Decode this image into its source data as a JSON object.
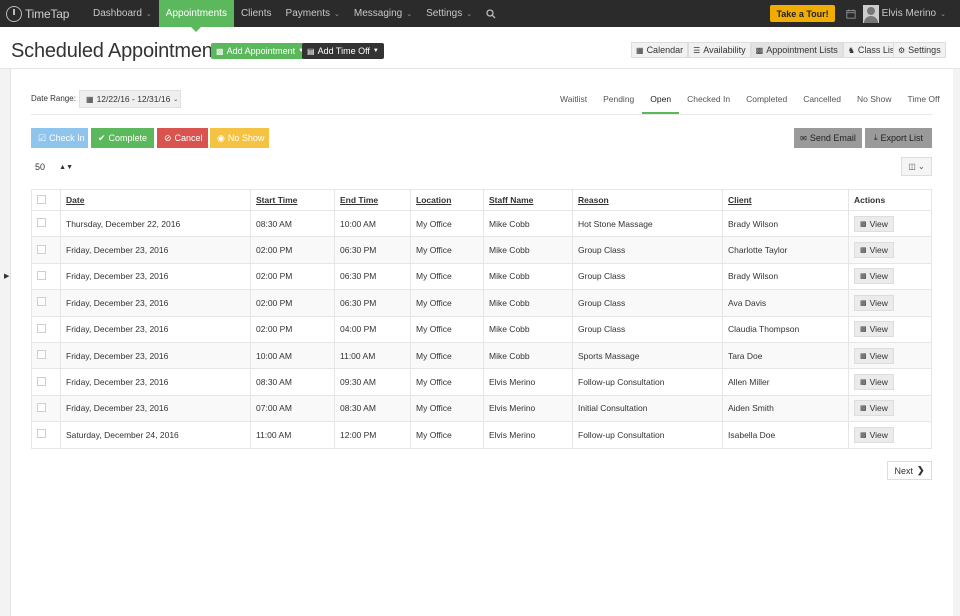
{
  "nav": {
    "logo_text": "TimeTap",
    "items": [
      {
        "label": "Dashboard",
        "has_chevron": true,
        "active": false
      },
      {
        "label": "Appointments",
        "has_chevron": false,
        "active": true
      },
      {
        "label": "Clients",
        "has_chevron": false,
        "active": false
      },
      {
        "label": "Payments",
        "has_chevron": true,
        "active": false
      },
      {
        "label": "Messaging",
        "has_chevron": true,
        "active": false
      },
      {
        "label": "Settings",
        "has_chevron": true,
        "active": false
      }
    ],
    "tour_label": "Take a Tour!",
    "user_name": "Elvis Merino",
    "colors": {
      "bar": "#2b2b2b",
      "active": "#5cb85c",
      "tour": "#f0ad00"
    }
  },
  "header": {
    "title": "Scheduled Appointments",
    "add_appointment_label": "Add Appointment",
    "add_time_off_label": "Add Time Off",
    "views": [
      {
        "label": "Calendar",
        "icon": "calendar-icon",
        "active": false
      },
      {
        "label": "Availability",
        "icon": "list-icon",
        "active": false
      },
      {
        "label": "Appointment Lists",
        "icon": "book-icon",
        "active": true
      },
      {
        "label": "Class Lists",
        "icon": "users-icon",
        "active": false
      }
    ],
    "settings_label": "Settings"
  },
  "filters": {
    "date_range_label": "Date Range:",
    "date_range_value": "12/22/16 - 12/31/16",
    "status_tabs": [
      {
        "label": "Waitlist",
        "active": false
      },
      {
        "label": "Pending",
        "active": false
      },
      {
        "label": "Open",
        "active": true
      },
      {
        "label": "Checked In",
        "active": false
      },
      {
        "label": "Completed",
        "active": false
      },
      {
        "label": "Cancelled",
        "active": false
      },
      {
        "label": "No Show",
        "active": false
      },
      {
        "label": "Time Off",
        "active": false
      }
    ]
  },
  "actions": {
    "check_in": "Check In",
    "complete": "Complete",
    "cancel": "Cancel",
    "no_show": "No Show",
    "send_email": "Send Email",
    "export_list": "Export List",
    "page_size": "50"
  },
  "table": {
    "columns": [
      "Date",
      "Start Time",
      "End Time",
      "Location",
      "Staff Name",
      "Reason",
      "Client",
      "Actions"
    ],
    "view_label": "View",
    "rows": [
      {
        "date": "Thursday, December 22, 2016",
        "start": "08:30 AM",
        "end": "10:00 AM",
        "location": "My Office",
        "staff": "Mike Cobb",
        "reason": "Hot Stone Massage",
        "client": "Brady Wilson"
      },
      {
        "date": "Friday, December 23, 2016",
        "start": "02:00 PM",
        "end": "06:30 PM",
        "location": "My Office",
        "staff": "Mike Cobb",
        "reason": "Group Class",
        "client": "Charlotte Taylor"
      },
      {
        "date": "Friday, December 23, 2016",
        "start": "02:00 PM",
        "end": "06:30 PM",
        "location": "My Office",
        "staff": "Mike Cobb",
        "reason": "Group Class",
        "client": "Brady Wilson"
      },
      {
        "date": "Friday, December 23, 2016",
        "start": "02:00 PM",
        "end": "06:30 PM",
        "location": "My Office",
        "staff": "Mike Cobb",
        "reason": "Group Class",
        "client": "Ava Davis"
      },
      {
        "date": "Friday, December 23, 2016",
        "start": "02:00 PM",
        "end": "04:00 PM",
        "location": "My Office",
        "staff": "Mike Cobb",
        "reason": "Group Class",
        "client": "Claudia Thompson"
      },
      {
        "date": "Friday, December 23, 2016",
        "start": "10:00 AM",
        "end": "11:00 AM",
        "location": "My Office",
        "staff": "Mike Cobb",
        "reason": "Sports Massage",
        "client": "Tara Doe"
      },
      {
        "date": "Friday, December 23, 2016",
        "start": "08:30 AM",
        "end": "09:30 AM",
        "location": "My Office",
        "staff": "Elvis Merino",
        "reason": "Follow-up Consultation",
        "client": "Allen Miller"
      },
      {
        "date": "Friday, December 23, 2016",
        "start": "07:00 AM",
        "end": "08:30 AM",
        "location": "My Office",
        "staff": "Elvis Merino",
        "reason": "Initial Consultation",
        "client": "Aiden Smith"
      },
      {
        "date": "Saturday, December 24, 2016",
        "start": "11:00 AM",
        "end": "12:00 PM",
        "location": "My Office",
        "staff": "Elvis Merino",
        "reason": "Follow-up Consultation",
        "client": "Isabella Doe"
      }
    ]
  },
  "pagination": {
    "next_label": "Next"
  }
}
